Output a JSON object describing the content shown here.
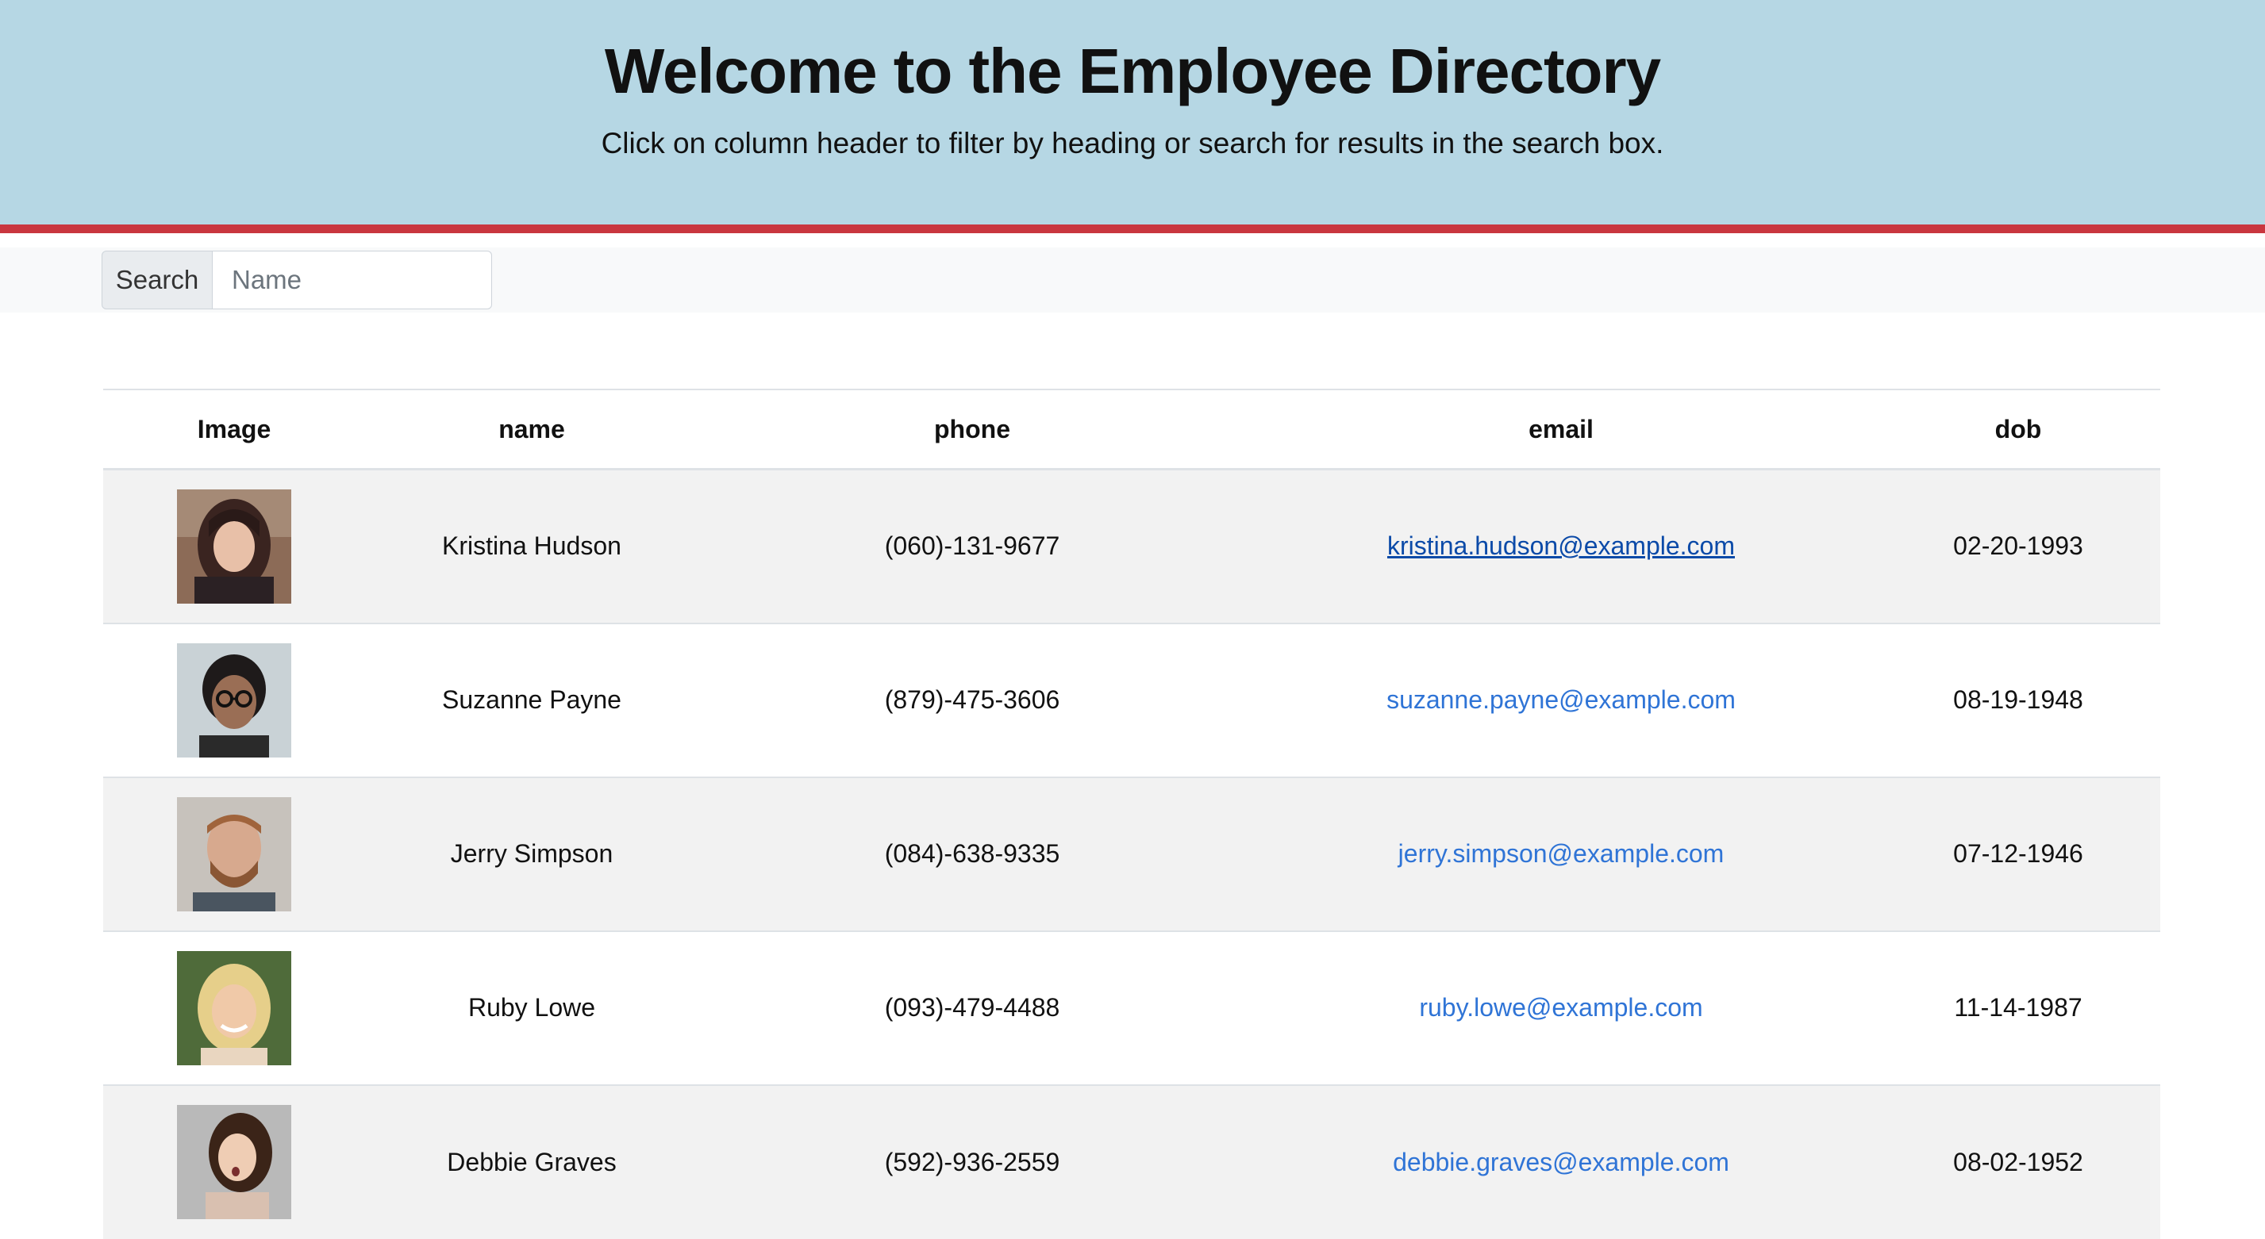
{
  "header": {
    "title": "Welcome to the Employee Directory",
    "subtitle": "Click on column header to filter by heading or search for results in the search box."
  },
  "search": {
    "label": "Search",
    "placeholder": "Name",
    "value": ""
  },
  "table": {
    "columns": [
      "Image",
      "name",
      "phone",
      "email",
      "dob"
    ],
    "rows": [
      {
        "name": "Kristina Hudson",
        "phone": "(060)-131-9677",
        "email": "kristina.hudson@example.com",
        "dob": "02-20-1993",
        "avatar": "portrait-woman-dark-hair"
      },
      {
        "name": "Suzanne Payne",
        "phone": "(879)-475-3606",
        "email": "suzanne.payne@example.com",
        "dob": "08-19-1948",
        "avatar": "portrait-woman-glasses"
      },
      {
        "name": "Jerry Simpson",
        "phone": "(084)-638-9335",
        "email": "jerry.simpson@example.com",
        "dob": "07-12-1946",
        "avatar": "portrait-man-beard"
      },
      {
        "name": "Ruby Lowe",
        "phone": "(093)-479-4488",
        "email": "ruby.lowe@example.com",
        "dob": "11-14-1987",
        "avatar": "portrait-woman-blonde"
      },
      {
        "name": "Debbie Graves",
        "phone": "(592)-936-2559",
        "email": "debbie.graves@example.com",
        "dob": "08-02-1952",
        "avatar": "portrait-woman-surprised"
      }
    ]
  },
  "colors": {
    "header_bg": "#b6d7e4",
    "accent_line": "#c9363f",
    "link": "#2f74d6"
  }
}
